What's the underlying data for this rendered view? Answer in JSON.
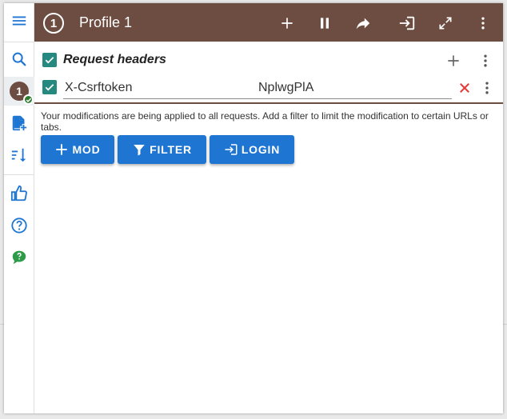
{
  "colors": {
    "header": "#6d4c41",
    "accent_blue": "#1e76d2",
    "checkbox": "#26897f",
    "delete_red": "#e53935",
    "green": "#2e7d32"
  },
  "sidebar": {
    "items": [
      {
        "icon": "menu-icon"
      },
      {
        "icon": "search-icon"
      },
      {
        "icon": "profile-badge",
        "label": "1"
      },
      {
        "icon": "add-file-icon"
      },
      {
        "icon": "sort-icon"
      },
      {
        "icon": "thumbs-up-icon"
      },
      {
        "icon": "help-icon"
      },
      {
        "icon": "feedback-chat-icon"
      }
    ]
  },
  "header": {
    "profile_number": "1",
    "title": "Profile 1",
    "actions": [
      "add-icon",
      "pause-icon",
      "share-icon",
      "login-icon",
      "expand-icon",
      "more-vert-icon"
    ]
  },
  "section": {
    "title": "Request headers",
    "enabled": true
  },
  "modification": {
    "enabled": true,
    "name": "X-Csrftoken",
    "value": "NplwgPlA"
  },
  "info_text": "Your modifications are being applied to all requests. Add a filter to limit the modification to certain URLs or tabs.",
  "buttons": {
    "mod": "MOD",
    "filter": "FILTER",
    "login": "LOGIN"
  }
}
